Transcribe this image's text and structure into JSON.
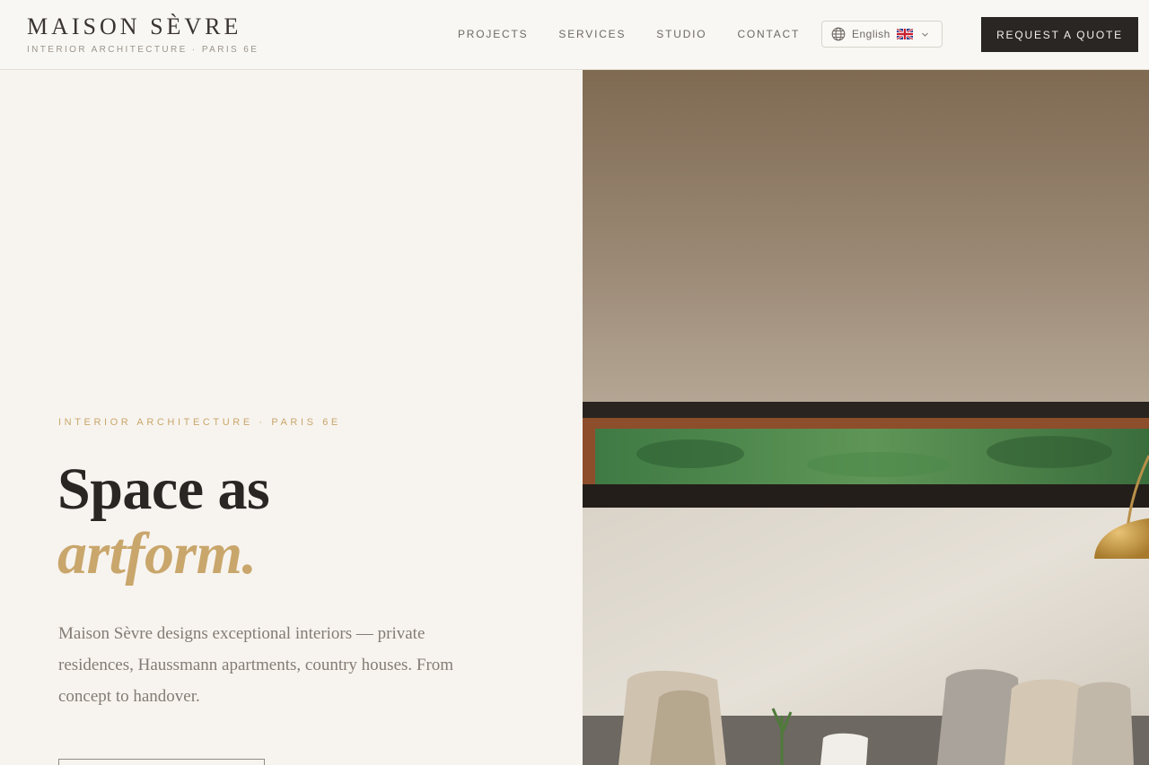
{
  "brand": {
    "name": "MAISON SÈVRE",
    "tagline": "INTERIOR ARCHITECTURE · PARIS 6E"
  },
  "nav": {
    "links": [
      "PROJECTS",
      "SERVICES",
      "STUDIO",
      "CONTACT"
    ]
  },
  "language": {
    "label": "English",
    "flag_icon": "uk-flag-icon",
    "globe_icon": "globe-icon",
    "chevron_icon": "chevron-down-icon"
  },
  "header": {
    "cta_label": "REQUEST A QUOTE"
  },
  "hero": {
    "eyebrow": "INTERIOR ARCHITECTURE · PARIS 6E",
    "headline": "Space as",
    "headline_accent": "artform.",
    "lead": "Maison Sèvre designs exceptional interiors — private residences, Haussmann apartments, country houses. From concept to handover."
  },
  "colors": {
    "accent_gold": "#c9a66b",
    "ink": "#2a2623",
    "background": "#f7f4ef"
  }
}
